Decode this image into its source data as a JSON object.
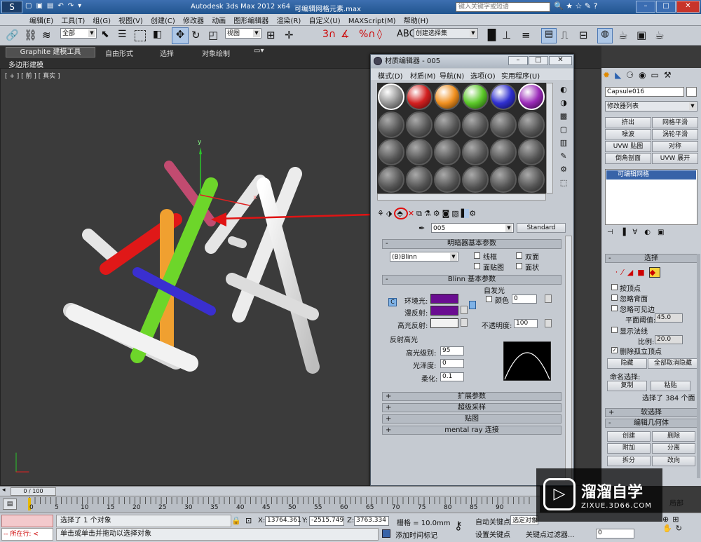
{
  "window": {
    "app_title": "Autodesk 3ds Max  2012 x64",
    "file_title": "可编辑网格元素.max",
    "search_placeholder": "键入关键字或短语"
  },
  "menu": [
    "编辑(E)",
    "工具(T)",
    "组(G)",
    "视图(V)",
    "创建(C)",
    "修改器",
    "动画",
    "图形编辑器",
    "渲染(R)",
    "自定义(U)",
    "MAXScript(M)",
    "帮助(H)"
  ],
  "toolbar": {
    "selection_filter": "全部",
    "ref_coord": "视图",
    "named_selection": "创建选择集"
  },
  "ribbon": {
    "tabs": [
      "Graphite 建模工具",
      "自由形式",
      "选择",
      "对象绘制"
    ],
    "sub": "多边形建模"
  },
  "viewport": {
    "label": "[ + ] [ 前 ] [ 真实 ]",
    "axis_y": "y",
    "axis_x": "x"
  },
  "material_editor": {
    "title": "材质编辑器 - 005",
    "menu": [
      "模式(D)",
      "材质(M)",
      "导航(N)",
      "选项(O)",
      "实用程序(U)"
    ],
    "material_name": "005",
    "material_type": "Standard",
    "shader_rollout": "明暗器基本参数",
    "shader": "(B)Blinn",
    "wire": "线框",
    "two_sided": "双面",
    "face_map": "面贴图",
    "faceted": "面状",
    "blinn_rollout": "Blinn 基本参数",
    "self_illum": "自发光",
    "color_label": "颜色",
    "color_value": "0",
    "ambient": "环境光:",
    "diffuse": "漫反射:",
    "specular": "高光反射:",
    "opacity_label": "不透明度:",
    "opacity_value": "100",
    "spec_highlights": "反射高光",
    "spec_level_label": "高光级别:",
    "spec_level": "95",
    "glossiness_label": "光泽度:",
    "glossiness": "0",
    "soften_label": "柔化:",
    "soften": "0.1",
    "collapsed_rollouts": [
      "扩展参数",
      "超级采样",
      "贴图",
      "mental ray 连接"
    ],
    "ambient_color": "#6a0d91",
    "diffuse_color": "#6a0d91"
  },
  "command_panel": {
    "object_name": "Capsule016",
    "modifier_list": "修改器列表",
    "buttons": [
      "挤出",
      "网格平滑",
      "噪波",
      "涡轮平滑",
      "UVW 贴图",
      "对称",
      "倒角剖面",
      "UVW 展开"
    ],
    "stack_item": "可编辑网格",
    "select_rollout": "选择",
    "by_vertex": "按顶点",
    "ignore_back": "忽略背面",
    "ignore_visible": "忽略可见边",
    "planar_thresh_label": "平面阈值:",
    "planar_thresh": "45.0",
    "show_normals": "显示法线",
    "scale_label": "比例:",
    "scale": "20.0",
    "delete_isolated": "删除孤立顶点",
    "hide": "隐藏",
    "unhide_all": "全部取消隐藏",
    "named_sel": "命名选择:",
    "copy": "复制",
    "paste": "粘贴",
    "selected_info": "选择了 384 个面",
    "soft_sel": "软选择",
    "edit_geo": "编辑几何体",
    "create": "创建",
    "delete": "删除",
    "attach": "附加",
    "detach": "分离",
    "break": "拆分",
    "turn": "改向",
    "local": "局部"
  },
  "timeline": {
    "counter": "0 / 100",
    "ticks": [
      "0",
      "5",
      "10",
      "15",
      "20",
      "25",
      "30",
      "35",
      "40",
      "45",
      "50",
      "55",
      "60",
      "65",
      "70",
      "75",
      "80",
      "85",
      "90"
    ]
  },
  "status": {
    "running": "所在行:",
    "selected": "选择了 1 个对象",
    "prompt": "单击或单击并拖动以选择对象",
    "x_label": "X:",
    "x": "13764.361",
    "y_label": "Y:",
    "y": "-2515.749",
    "z_label": "Z:",
    "z": "3763.334",
    "grid": "栅格 = 10.0mm",
    "add_time_tag": "添加时间标记",
    "auto_key": "自动关键点",
    "selected_obj": "选定对象",
    "set_key": "设置关键点",
    "key_filters": "关键点过滤器...",
    "frame": "0"
  },
  "watermark": {
    "brand": "溜溜自学",
    "url": "ZIXUE.3D66.COM"
  }
}
